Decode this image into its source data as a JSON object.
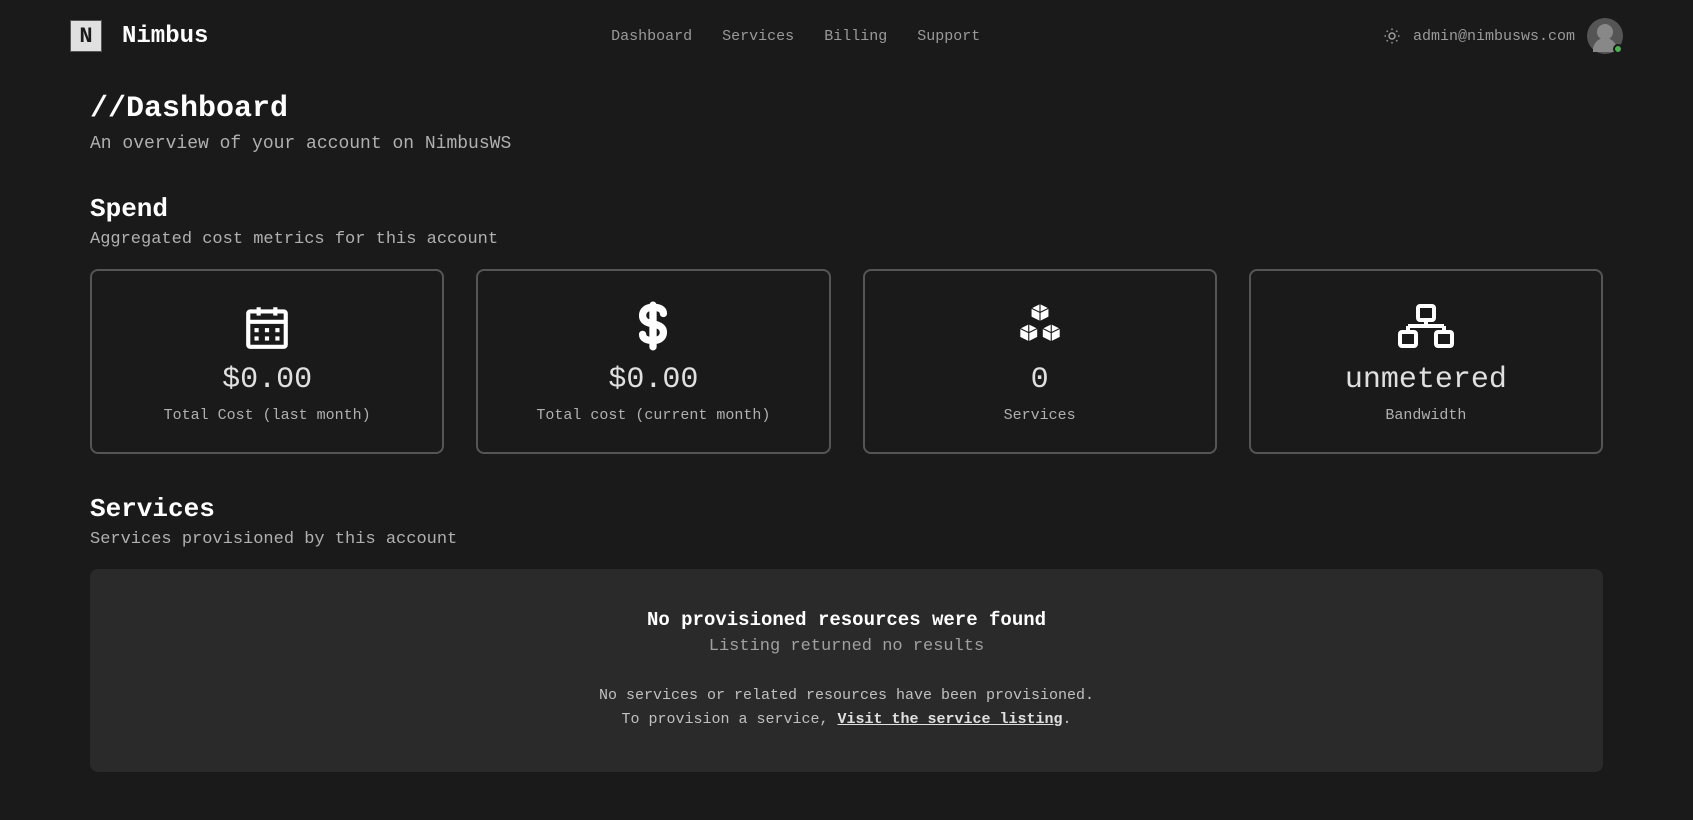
{
  "header": {
    "brand": "Nimbus",
    "logo_letter": "N",
    "nav": [
      {
        "label": "Dashboard"
      },
      {
        "label": "Services"
      },
      {
        "label": "Billing"
      },
      {
        "label": "Support"
      }
    ],
    "user_email": "admin@nimbusws.com"
  },
  "page": {
    "title_prefix": "//",
    "title": "Dashboard",
    "subtitle": "An overview of your account on NimbusWS"
  },
  "spend_section": {
    "title": "Spend",
    "subtitle": "Aggregated cost metrics for this account",
    "cards": [
      {
        "value": "$0.00",
        "label": "Total Cost (last month)",
        "icon": "calendar"
      },
      {
        "value": "$0.00",
        "label": "Total cost (current month)",
        "icon": "dollar"
      },
      {
        "value": "0",
        "label": "Services",
        "icon": "cubes"
      },
      {
        "value": "unmetered",
        "label": "Bandwidth",
        "icon": "network"
      }
    ]
  },
  "services_section": {
    "title": "Services",
    "subtitle": "Services provisioned by this account",
    "empty": {
      "title": "No provisioned resources were found",
      "subtitle": "Listing returned no results",
      "line1": "No services or related resources have been provisioned.",
      "line2_prefix": "To provision a service, ",
      "link_text": "Visit the service listing",
      "line2_suffix": "."
    }
  }
}
